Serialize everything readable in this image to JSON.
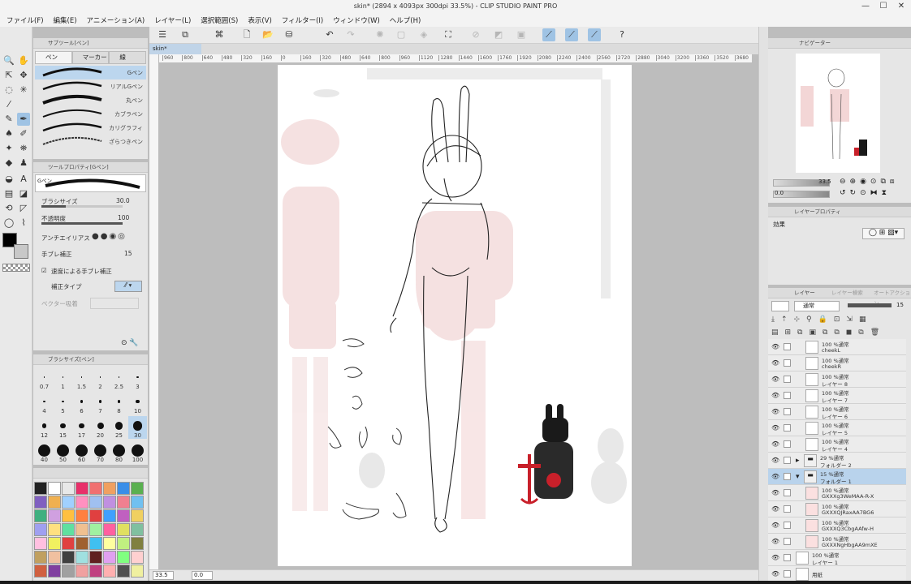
{
  "window": {
    "title": "skin* (2894 x 4093px 300dpi 33.5%) - CLIP STUDIO PAINT PRO",
    "minimize": "—",
    "maximize": "☐",
    "close": "✕"
  },
  "menu": [
    "ファイル(F)",
    "編集(E)",
    "アニメーション(A)",
    "レイヤー(L)",
    "選択範囲(S)",
    "表示(V)",
    "フィルター(I)",
    "ウィンドウ(W)",
    "ヘルプ(H)"
  ],
  "document_tab": "skin*",
  "subtool_panel": {
    "title": "サブツール[ペン]",
    "groups": [
      "ペン",
      "マーカー",
      "線"
    ],
    "brushes": [
      "Gペン",
      "リアルGペン",
      "丸ペン",
      "カブラペン",
      "カリグラフィ",
      "ざらつきペン"
    ]
  },
  "tool_property": {
    "title": "ツールプロパティ[Gペン]",
    "preset": "Gペン",
    "brush_size_label": "ブラシサイズ",
    "brush_size_value": "30.0",
    "opacity_label": "不透明度",
    "opacity_value": "100",
    "antialias_label": "アンチエイリアス",
    "stabilization_label": "手ブレ補正",
    "stabilization_value": "15",
    "speed_stab_label": "速度による手ブレ補正",
    "stab_type_label": "補正タイプ",
    "vector_label": "ベクター吸着"
  },
  "brush_size_panel": {
    "title": "ブラシサイズ[ペン]",
    "sizes": [
      "0.7",
      "1",
      "1.5",
      "2",
      "2.5",
      "3",
      "4",
      "5",
      "6",
      "7",
      "8",
      "10",
      "12",
      "15",
      "17",
      "20",
      "25",
      "30",
      "40",
      "50",
      "60",
      "70",
      "80",
      "100"
    ],
    "selected": "30"
  },
  "colors": {
    "main": "#000000",
    "sub": "#c8c8c8",
    "swatches": [
      "#222222",
      "#ffffff",
      "#e8e8e8",
      "#e8306a",
      "#f07070",
      "#f0a060",
      "#3a8ee8",
      "#5ab050",
      "#8060c0",
      "#f0b050",
      "#a0d0ff",
      "#ff90c0",
      "#a0c0f0",
      "#c090e0",
      "#f08090",
      "#70c0f0",
      "#40b080",
      "#d0a0e0",
      "#ffc040",
      "#ff8040",
      "#e04040",
      "#40a0ff",
      "#c060c0",
      "#f0d060",
      "#a0a0f0",
      "#ffe080",
      "#60e0a0",
      "#f0c090",
      "#a0f0a0",
      "#ff60a0",
      "#e0e060",
      "#80c0a0",
      "#ffc0e0",
      "#f0f060",
      "#e04040",
      "#a06030",
      "#40c0f0",
      "#ffffa0",
      "#c0f080",
      "#808040",
      "#c0a060",
      "#f0c0a0",
      "#404040",
      "#a0e0e0",
      "#602020",
      "#e0a0f0",
      "#80ff80",
      "#ffd0d0",
      "#d06040",
      "#8040a0",
      "#a0a0a0",
      "#f0a0a0",
      "#c04080",
      "#ffb0b0",
      "#505050",
      "#f0f0a0"
    ]
  },
  "ruler_ticks": [
    "960",
    "800",
    "640",
    "480",
    "320",
    "160",
    "0",
    "160",
    "320",
    "480",
    "640",
    "800",
    "960",
    "1120",
    "1280",
    "1440",
    "1600",
    "1760",
    "1920",
    "2080",
    "2240",
    "2400",
    "2560",
    "2720",
    "2880",
    "3040",
    "3200",
    "3360",
    "3520",
    "3680"
  ],
  "status": {
    "zoom": "33.5",
    "angle": "0.0"
  },
  "navigator": {
    "title": "ナビゲーター",
    "zoom": "33.5",
    "angle": "0.0"
  },
  "layer_property": {
    "title": "レイヤープロパティ",
    "effect_label": "効果"
  },
  "layer_panel": {
    "tabs": [
      "レイヤー",
      "レイヤー検索",
      "オートアクション"
    ],
    "blend_mode": "通常",
    "opacity": "15",
    "layers": [
      {
        "line1": "100 %通常",
        "line2": "cheekL",
        "kind": "vector",
        "indent": 1,
        "selected": false
      },
      {
        "line1": "100 %通常",
        "line2": "cheekR",
        "kind": "vector",
        "indent": 1,
        "selected": false
      },
      {
        "line1": "100 %通常",
        "line2": "レイヤー 8",
        "kind": "vector",
        "indent": 1,
        "selected": false
      },
      {
        "line1": "100 %通常",
        "line2": "レイヤー 7",
        "kind": "vector",
        "indent": 1,
        "selected": false
      },
      {
        "line1": "100 %通常",
        "line2": "レイヤー 6",
        "kind": "vector",
        "indent": 1,
        "selected": false
      },
      {
        "line1": "100 %通常",
        "line2": "レイヤー 5",
        "kind": "vector",
        "indent": 1,
        "selected": false
      },
      {
        "line1": "100 %通常",
        "line2": "レイヤー 4",
        "kind": "vector",
        "indent": 1,
        "selected": false
      },
      {
        "line1": "29 %通常",
        "line2": "フォルダー 2",
        "kind": "folder",
        "indent": 0,
        "selected": false
      },
      {
        "line1": "15 %通常",
        "line2": "フォルダー 1",
        "kind": "folder",
        "indent": 0,
        "selected": true
      },
      {
        "line1": "100 %通常",
        "line2": "GXXXg3WeMAA-R-X",
        "kind": "image",
        "indent": 1,
        "selected": false
      },
      {
        "line1": "100 %通常",
        "line2": "GXXXQJRaxAA7BG6",
        "kind": "image",
        "indent": 1,
        "selected": false
      },
      {
        "line1": "100 %通常",
        "line2": "GXXXQ3CbgAAfw-H",
        "kind": "image",
        "indent": 1,
        "selected": false
      },
      {
        "line1": "100 %通常",
        "line2": "GXXXNgHbgAA9mXE",
        "kind": "image",
        "indent": 1,
        "selected": false
      },
      {
        "line1": "100 %通常",
        "line2": "レイヤー 1",
        "kind": "raster",
        "indent": 0,
        "selected": false
      },
      {
        "line1": "",
        "line2": "用紙",
        "kind": "paper",
        "indent": 0,
        "selected": false
      }
    ]
  }
}
